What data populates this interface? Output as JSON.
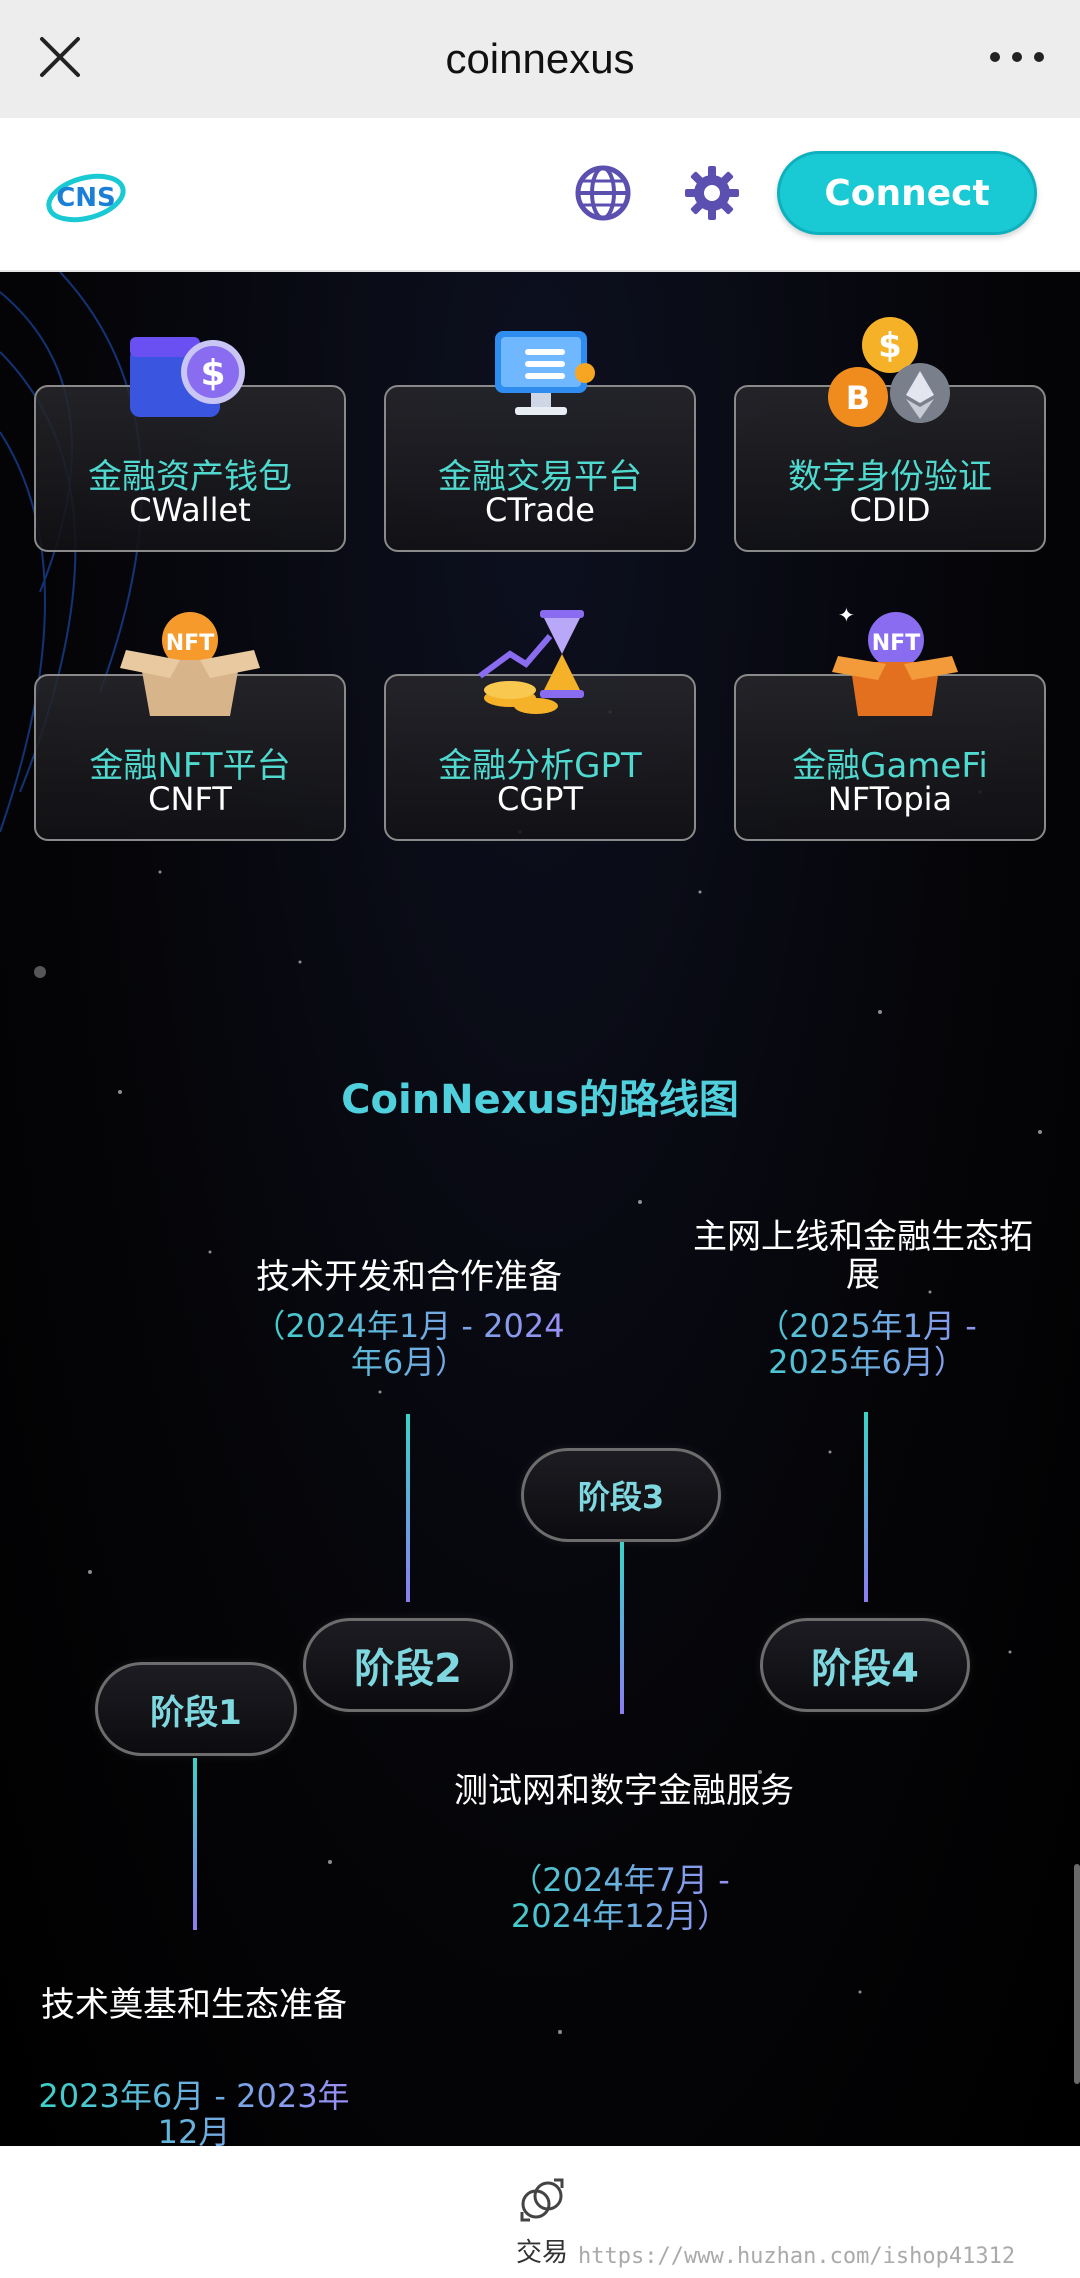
{
  "browser": {
    "title": "coinnexus"
  },
  "header": {
    "connect_label": "Connect"
  },
  "products": [
    {
      "cn": "金融资产钱包",
      "en": "CWallet",
      "icon": "wallet-dollar-icon"
    },
    {
      "cn": "金融交易平台",
      "en": "CTrade",
      "icon": "trading-terminal-icon"
    },
    {
      "cn": "数字身份验证",
      "en": "CDID",
      "icon": "crypto-coins-icon"
    },
    {
      "cn": "金融NFT平台",
      "en": "CNFT",
      "icon": "nft-box-icon"
    },
    {
      "cn": "金融分析GPT",
      "en": "CGPT",
      "icon": "hourglass-coins-icon"
    },
    {
      "cn": "金融GameFi",
      "en": "NFTopia",
      "icon": "nft-gift-box-icon"
    }
  ],
  "roadmap": {
    "title": "CoinNexus的路线图",
    "stages": [
      {
        "label": "阶段1",
        "text": "技术奠基和生态准备",
        "date": "2023年6月 - 2023年12月"
      },
      {
        "label": "阶段2",
        "text": "技术开发和合作准备",
        "date": "（2024年1月 - 2024年6月）"
      },
      {
        "label": "阶段3",
        "text": "测试网和数字金融服务",
        "date": "（2024年7月 - 2024年12月）"
      },
      {
        "label": "阶段4",
        "text": "主网上线和金融生态拓展",
        "date": "（2025年1月 - 2025年6月）"
      }
    ]
  },
  "bottom_nav": {
    "trade_label": "交易"
  },
  "watermark": "https://www.huzhan.com/ishop41312"
}
